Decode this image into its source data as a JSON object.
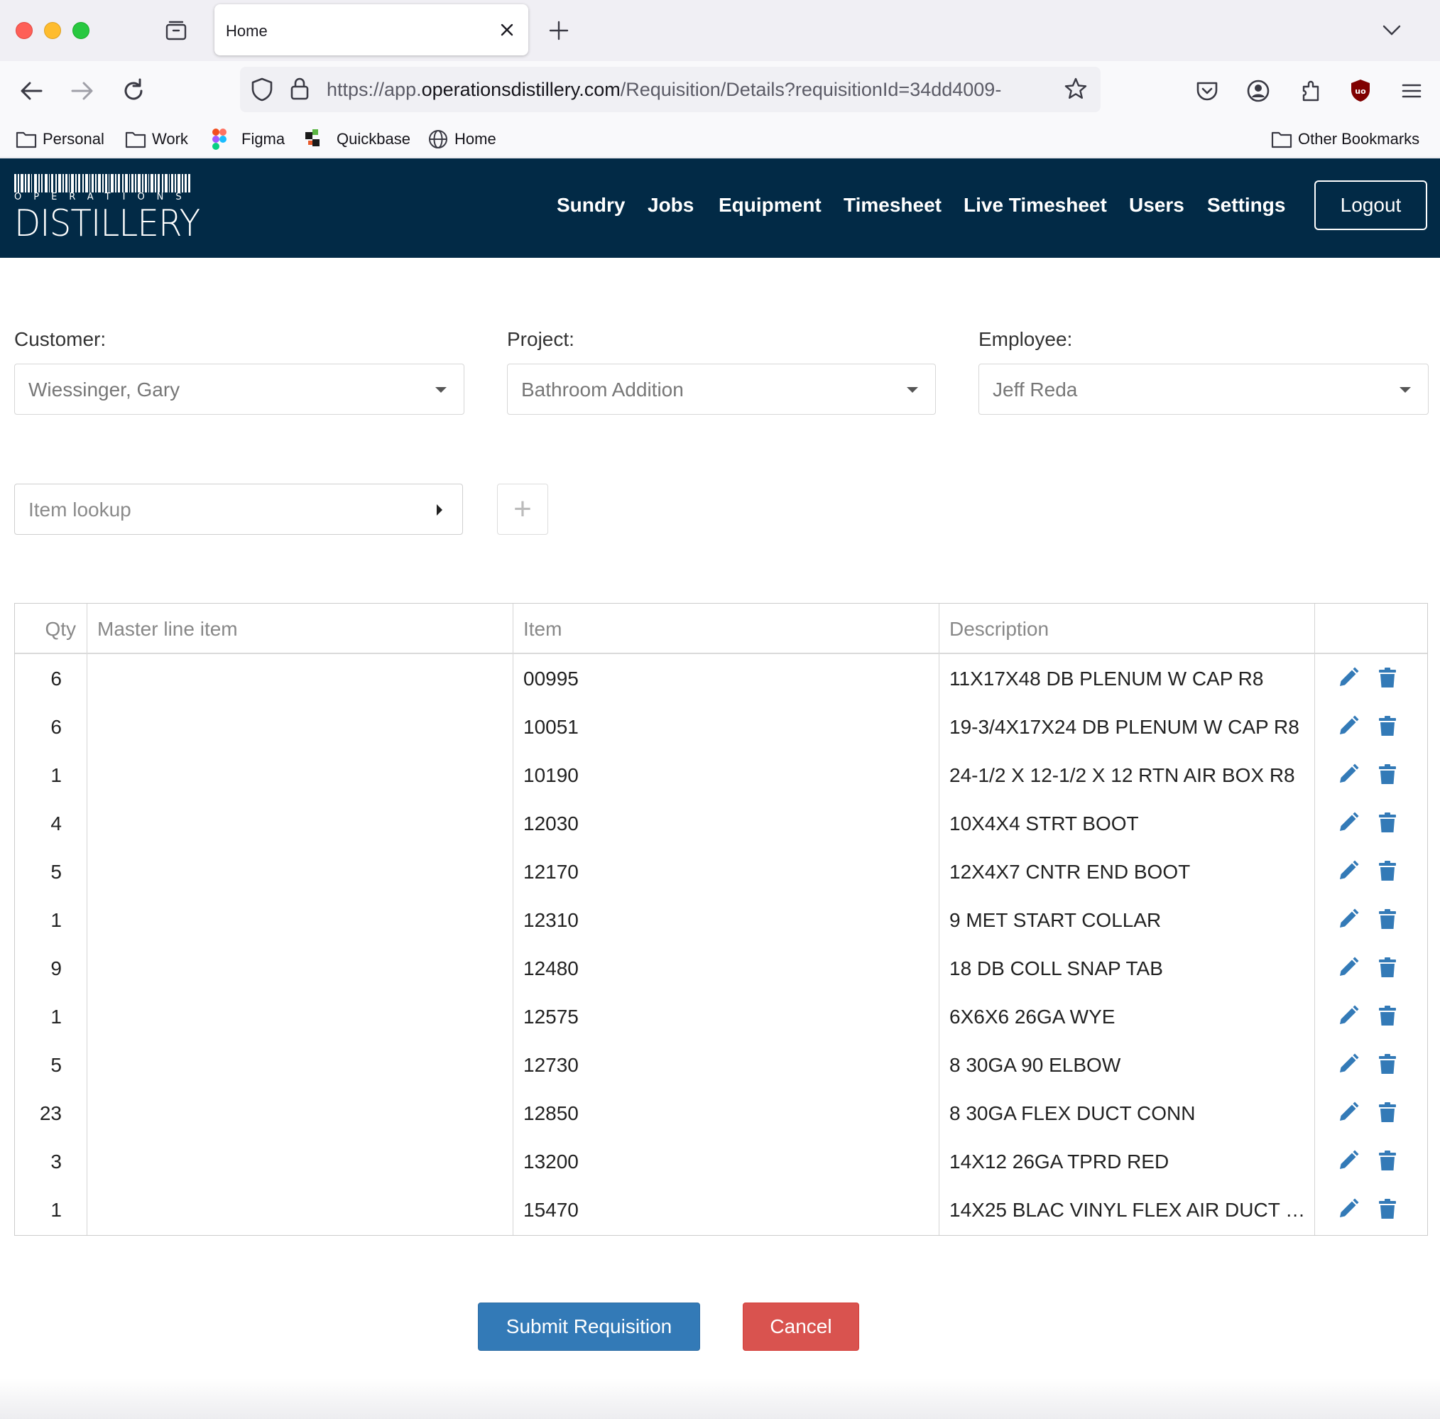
{
  "browser": {
    "tab_title": "Home",
    "url_prefix": "https://app.",
    "url_host": "operationsdistillery.com",
    "url_path": "/Requisition/Details?requisitionId=34dd4009-",
    "bookmarks": [
      "Personal",
      "Work",
      "Figma",
      "Quickbase",
      "Home"
    ],
    "other_bookmarks": "Other Bookmarks"
  },
  "app": {
    "logo_top": "OPERATIONS",
    "logo_bottom": "DISTILLERY",
    "menu": [
      "Sundry",
      "Jobs",
      "Equipment",
      "Timesheet",
      "Live Timesheet",
      "Users",
      "Settings"
    ],
    "logout": "Logout",
    "brand_color": "#022a46"
  },
  "form": {
    "customer_label": "Customer:",
    "customer_value": "Wiessinger, Gary",
    "project_label": "Project:",
    "project_value": "Bathroom Addition",
    "employee_label": "Employee:",
    "employee_value": "Jeff Reda",
    "item_lookup_placeholder": "Item lookup",
    "add_symbol": "+"
  },
  "table": {
    "headers": [
      "Qty",
      "Master line item",
      "Item",
      "Description"
    ],
    "rows": [
      {
        "qty": "6",
        "master": "",
        "item": "00995",
        "desc": "11X17X48 DB PLENUM W CAP R8"
      },
      {
        "qty": "6",
        "master": "",
        "item": "10051",
        "desc": "19-3/4X17X24 DB PLENUM W CAP R8"
      },
      {
        "qty": "1",
        "master": "",
        "item": "10190",
        "desc": "24-1/2 X 12-1/2 X 12 RTN AIR BOX R8"
      },
      {
        "qty": "4",
        "master": "",
        "item": "12030",
        "desc": "10X4X4 STRT BOOT"
      },
      {
        "qty": "5",
        "master": "",
        "item": "12170",
        "desc": "12X4X7 CNTR END BOOT"
      },
      {
        "qty": "1",
        "master": "",
        "item": "12310",
        "desc": "9 MET START COLLAR"
      },
      {
        "qty": "9",
        "master": "",
        "item": "12480",
        "desc": "18 DB COLL SNAP TAB"
      },
      {
        "qty": "1",
        "master": "",
        "item": "12575",
        "desc": "6X6X6 26GA WYE"
      },
      {
        "qty": "5",
        "master": "",
        "item": "12730",
        "desc": "8 30GA 90 ELBOW"
      },
      {
        "qty": "23",
        "master": "",
        "item": "12850",
        "desc": "8 30GA FLEX DUCT CONN"
      },
      {
        "qty": "3",
        "master": "",
        "item": "13200",
        "desc": "14X12 26GA TPRD RED"
      },
      {
        "qty": "1",
        "master": "",
        "item": "15470",
        "desc": "14X25 BLAC VINYL FLEX AIR DUCT …"
      }
    ],
    "action_icons": [
      "pencil-icon",
      "trash-icon"
    ],
    "action_color": "#337ab7"
  },
  "actions": {
    "submit": "Submit Requisition",
    "cancel": "Cancel"
  }
}
